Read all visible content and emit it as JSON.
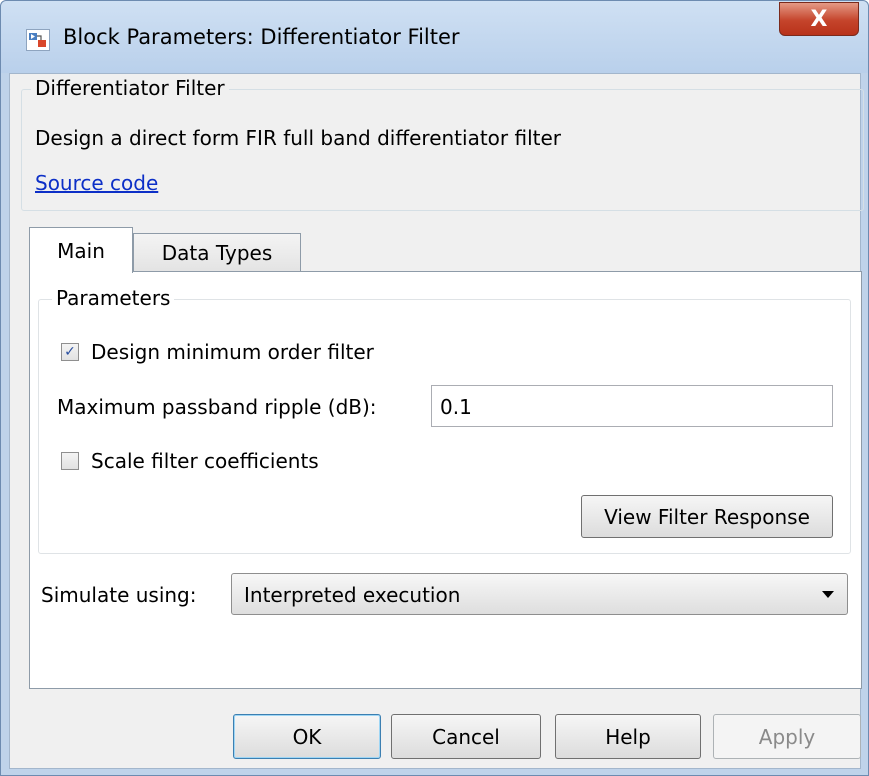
{
  "window": {
    "title": "Block Parameters: Differentiator Filter",
    "close_label": "X"
  },
  "description": {
    "group_label": "Differentiator Filter",
    "text": "Design a direct form FIR full band differentiator filter",
    "link": "Source code"
  },
  "tabs": [
    {
      "label": "Main",
      "active": true
    },
    {
      "label": "Data Types",
      "active": false
    }
  ],
  "parameters": {
    "group_label": "Parameters",
    "min_order": {
      "label": "Design minimum order filter",
      "checked": true,
      "mark": "✓"
    },
    "ripple": {
      "label": "Maximum passband ripple (dB):",
      "value": "0.1"
    },
    "scale": {
      "label": "Scale filter coefficients",
      "checked": false
    },
    "view_response_label": "View Filter Response"
  },
  "simulate": {
    "label": "Simulate using:",
    "value": "Interpreted execution"
  },
  "buttons": {
    "ok": "OK",
    "cancel": "Cancel",
    "help": "Help",
    "apply": "Apply"
  },
  "colors": {
    "link": "#0c2fc7",
    "close_button": "#c5442b",
    "title_bar": "#bfd3ea"
  }
}
